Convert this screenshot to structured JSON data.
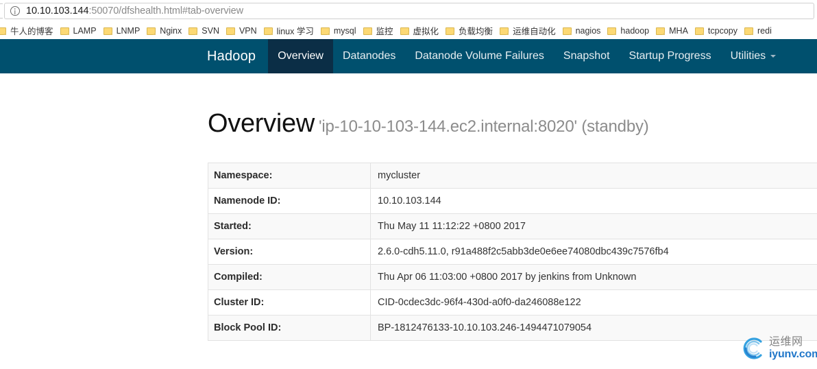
{
  "browser": {
    "url": {
      "host": "10.10.103.144",
      "rest": ":50070/dfshealth.html#tab-overview",
      "info_icon": "info-circle-icon"
    },
    "bookmarks": [
      {
        "label": "牛人的博客",
        "icon": "folder-icon"
      },
      {
        "label": "LAMP",
        "icon": "folder-icon"
      },
      {
        "label": "LNMP",
        "icon": "folder-icon"
      },
      {
        "label": "Nginx",
        "icon": "folder-icon"
      },
      {
        "label": "SVN",
        "icon": "folder-icon"
      },
      {
        "label": "VPN",
        "icon": "folder-icon"
      },
      {
        "label": "linux 学习",
        "icon": "folder-icon"
      },
      {
        "label": "mysql",
        "icon": "folder-icon"
      },
      {
        "label": "监控",
        "icon": "folder-icon"
      },
      {
        "label": "虚拟化",
        "icon": "folder-icon"
      },
      {
        "label": "负载均衡",
        "icon": "folder-icon"
      },
      {
        "label": "运维自动化",
        "icon": "folder-icon"
      },
      {
        "label": "nagios",
        "icon": "folder-icon"
      },
      {
        "label": "hadoop",
        "icon": "folder-icon"
      },
      {
        "label": "MHA",
        "icon": "folder-icon"
      },
      {
        "label": "tcpcopy",
        "icon": "folder-icon"
      },
      {
        "label": "redi",
        "icon": "folder-icon"
      }
    ]
  },
  "navbar": {
    "brand": "Hadoop",
    "background_color": "#00506e",
    "active_background_color": "#0b2e46",
    "items": [
      {
        "label": "Overview",
        "active": true
      },
      {
        "label": "Datanodes",
        "active": false
      },
      {
        "label": "Datanode Volume Failures",
        "active": false
      },
      {
        "label": "Snapshot",
        "active": false
      },
      {
        "label": "Startup Progress",
        "active": false
      },
      {
        "label": "Utilities",
        "active": false,
        "caret": "chevron-down-icon"
      }
    ]
  },
  "page": {
    "heading": "Overview",
    "heading_subtitle": "'ip-10-10-103-144.ec2.internal:8020' (standby)"
  },
  "overview_table": {
    "rows": [
      {
        "key": "Namespace:",
        "value": "mycluster"
      },
      {
        "key": "Namenode ID:",
        "value": "10.10.103.144"
      },
      {
        "key": "Started:",
        "value": "Thu May 11 11:12:22 +0800 2017"
      },
      {
        "key": "Version:",
        "value": "2.6.0-cdh5.11.0, r91a488f2c5abb3de0e6ee74080dbc439c7576fb4"
      },
      {
        "key": "Compiled:",
        "value": "Thu Apr 06 11:03:00 +0800 2017 by jenkins from Unknown"
      },
      {
        "key": "Cluster ID:",
        "value": "CID-0cdec3dc-96f4-430d-a0f0-da246088e122"
      },
      {
        "key": "Block Pool ID:",
        "value": "BP-1812476133-10.10.103.246-1494471079054"
      }
    ]
  },
  "watermark": {
    "cn_text": "运维网",
    "en_text": "iyunv.com",
    "accent_color": "#1a73c8"
  }
}
